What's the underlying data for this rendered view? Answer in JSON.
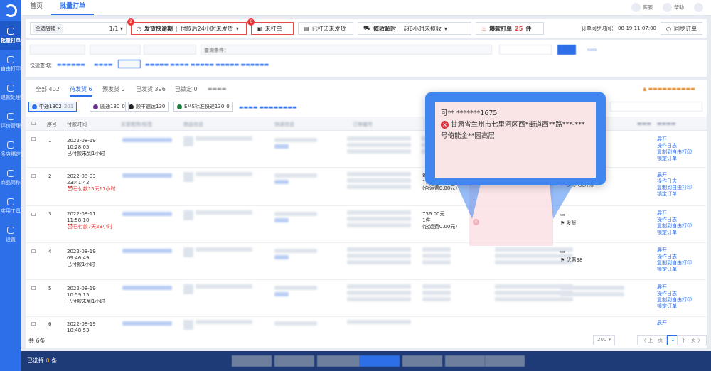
{
  "sidebar": {
    "items": [
      {
        "label": "批量打单",
        "active": true
      },
      {
        "label": "自由打印"
      },
      {
        "label": "退款处理"
      },
      {
        "label": "评价管理"
      },
      {
        "label": "多店绑定"
      },
      {
        "label": "商品简称"
      },
      {
        "label": "实用工具"
      },
      {
        "label": "设置"
      }
    ]
  },
  "topbar": {
    "tabs": [
      "首页",
      "批量打单"
    ],
    "right": [
      "客服",
      "帮助"
    ]
  },
  "filterbar": {
    "store_tag": "全选店铺",
    "store_count": "1/1",
    "ship_deadline_label": "发货快逾期",
    "ship_deadline_value": "付款后24小时未发货",
    "badge1": "2",
    "unprinted_label": "未打单",
    "badge2": "6",
    "printed_unshipped": "已打印未发货",
    "collect_timeout_label": "揽收超时",
    "collect_timeout_value": "超6小时未揽收",
    "hot_print_prefix": "爆款打单",
    "hot_print_count": "25",
    "hot_print_suffix": "件",
    "sync_time": "订单同步时间： 08-19 11:07:00",
    "sync_button": "同步订单"
  },
  "search": {
    "hint": "查询条件：",
    "quick": "快捷查询："
  },
  "status_tabs": [
    {
      "label": "全部 402"
    },
    {
      "label": "待发货 6",
      "active": true
    },
    {
      "label": "预发货 0"
    },
    {
      "label": "已发货 396"
    },
    {
      "label": "已锁定 0"
    }
  ],
  "carriers": [
    {
      "label": "中通1302",
      "count": "201",
      "active": true
    },
    {
      "label": "圆通130",
      "count": "0"
    },
    {
      "label": "顺丰速运130"
    },
    {
      "label": "EMS标准快递130",
      "count": "0"
    }
  ],
  "table": {
    "headers": [
      "序号",
      "付款时间",
      "买家昵称/标签",
      "商品信息",
      "快递信息",
      "订单编号"
    ],
    "rows": [
      {
        "no": "1",
        "date": "2022-08-19",
        "time": "10:28:05",
        "status": "已付款未到1小时",
        "warn": false
      },
      {
        "no": "2",
        "date": "2022-08-03",
        "time": "23:41:42",
        "status": "已付款15天11小时",
        "warn": true,
        "amount": "876",
        "note": "多带4支浮漂"
      },
      {
        "no": "3",
        "date": "2022-08-11",
        "time": "11:58:10",
        "status": "已付款7天23小时",
        "warn": true,
        "amount": "756.00元",
        "qty": "1件",
        "ship": "(含运费0.00元)",
        "note": "发货"
      },
      {
        "no": "4",
        "date": "2022-08-19",
        "time": "09:46:49",
        "status": "已付款1小时",
        "warn": false,
        "note": "优惠38"
      },
      {
        "no": "5",
        "date": "2022-08-19",
        "time": "10:59:15",
        "status": "已付款未到1小时",
        "warn": false
      },
      {
        "no": "6",
        "date": "2022-08-19",
        "time": "10:48:53",
        "status": "",
        "warn": false
      }
    ],
    "partial_amount_qty": "1件",
    "partial_ship": "(含运费0.00元)",
    "ops": [
      "展开",
      "操作日志",
      "复制到自由打印",
      "锁定订单"
    ]
  },
  "footer": {
    "total": "共 6条",
    "per_page": "200",
    "prev": "上一页",
    "page": "1",
    "next": "下一页"
  },
  "bottombar": {
    "selected_prefix": "已选择",
    "selected_count": "0",
    "selected_suffix": "条"
  },
  "overlay": {
    "line1": "可**    *******1675",
    "line2": "甘肃省兰州市七里河区西*街道西**路***-***",
    "line3": "号倚能金**园高层"
  },
  "colors": {
    "primary": "#2d6fe8",
    "danger": "#e34a4a",
    "overlay": "#3f86f0",
    "overlay_bg": "#f9e4e6"
  }
}
